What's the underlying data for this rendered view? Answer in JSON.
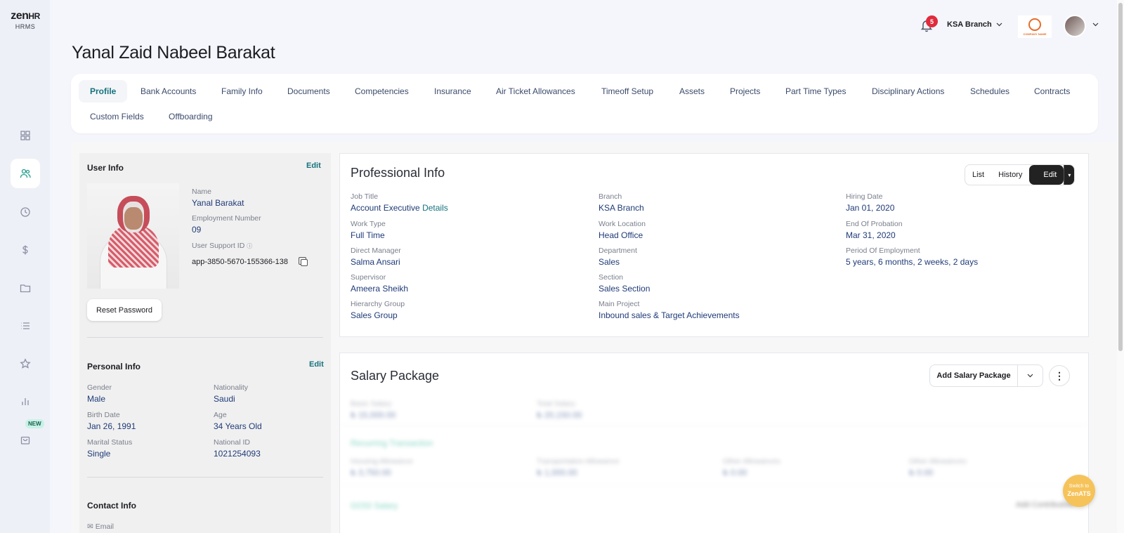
{
  "brand": {
    "name_main": "zen",
    "name_accent": "HR",
    "subtitle": "HRMS"
  },
  "sidebar": {
    "new_badge": "NEW",
    "icons": [
      "dashboard-icon",
      "people-icon",
      "clock-icon",
      "dollar-icon",
      "folder-icon",
      "list-icon",
      "star-icon",
      "chart-icon",
      "bag-icon"
    ]
  },
  "topbar": {
    "notification_count": "5",
    "branch": "KSA Branch",
    "company_logo_text": "COMPANY NAME"
  },
  "page": {
    "title": "Yanal Zaid Nabeel Barakat"
  },
  "tabs": [
    "Profile",
    "Bank Accounts",
    "Family Info",
    "Documents",
    "Competencies",
    "Insurance",
    "Air Ticket Allowances",
    "Timeoff Setup",
    "Assets",
    "Projects",
    "Part Time Types",
    "Disciplinary Actions",
    "Schedules",
    "Contracts",
    "Custom Fields",
    "Offboarding"
  ],
  "user_info": {
    "title": "User Info",
    "edit": "Edit",
    "name_label": "Name",
    "name": "Yanal Barakat",
    "emp_no_label": "Employment Number",
    "emp_no": "09",
    "support_label": "User Support ID",
    "support_id": "app-3850-5670-155366-138",
    "reset": "Reset Password"
  },
  "personal_info": {
    "title": "Personal Info",
    "edit": "Edit",
    "gender_label": "Gender",
    "gender": "Male",
    "nationality_label": "Nationality",
    "nationality": "Saudi",
    "birth_label": "Birth Date",
    "birth": "Jan 26, 1991",
    "age_label": "Age",
    "age": "34 Years Old",
    "marital_label": "Marital Status",
    "marital": "Single",
    "national_label": "National ID",
    "national": "1021254093"
  },
  "contact_info": {
    "title": "Contact Info",
    "email_label": "Email"
  },
  "professional": {
    "title": "Professional Info",
    "actions": {
      "list": "List",
      "history": "History",
      "edit": "Edit"
    },
    "job_title_label": "Job Title",
    "job_title": "Account Executive",
    "details": "Details",
    "branch_label": "Branch",
    "branch": "KSA Branch",
    "hiring_label": "Hiring Date",
    "hiring": "Jan 01, 2020",
    "work_type_label": "Work Type",
    "work_type": "Full Time",
    "work_loc_label": "Work Location",
    "work_loc": "Head Office",
    "probation_label": "End Of Probation",
    "probation": "Mar 31, 2020",
    "manager_label": "Direct Manager",
    "manager": "Salma Ansari",
    "dept_label": "Department",
    "dept": "Sales",
    "period_label": "Period Of Employment",
    "period": "5 years, 6 months, 2 weeks, 2 days",
    "supervisor_label": "Supervisor",
    "supervisor": "Ameera Sheikh",
    "section_label": "Section",
    "section": "Sales Section",
    "hierarchy_label": "Hierarchy Group",
    "hierarchy": "Sales Group",
    "project_label": "Main Project",
    "project": "Inbound sales & Target Achievements"
  },
  "salary": {
    "title": "Salary Package",
    "add": "Add Salary Package",
    "basic_label": "Basic Salary",
    "basic": "₺ 15,000.00",
    "total_label": "Total Salary",
    "total": "₺ 20,150.00",
    "recurring": "Recurring Transaction",
    "housing_label": "Housing Allowance",
    "housing": "₺ 3,750.00",
    "transport_label": "Transportation Allowance",
    "transport": "₺ 1,000.00",
    "other1_label": "Other Allowances",
    "other1": "₺ 0.00",
    "other2_label": "Other Allowances",
    "other2": "₺ 0.00",
    "gosi": "GOSI Salary",
    "add_contribution": "Add Contribution"
  },
  "fab": {
    "line1": "Switch to",
    "line2": "ZenATS"
  }
}
